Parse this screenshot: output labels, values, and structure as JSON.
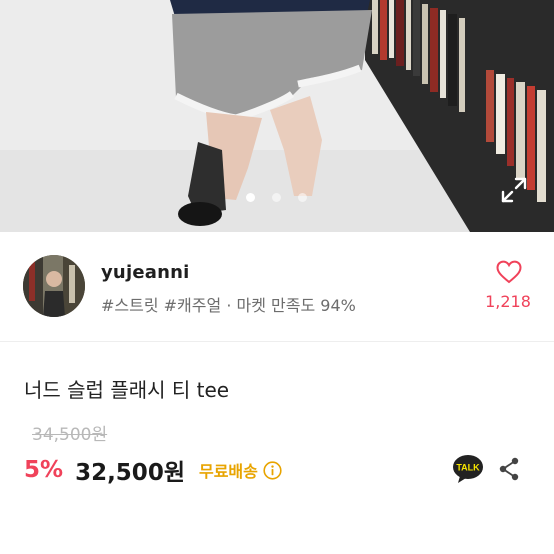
{
  "gallery": {
    "slide_count": 3,
    "active_index": 0,
    "icons": {
      "expand": "expand-icon"
    }
  },
  "seller": {
    "name": "yujeanni",
    "tags": "#스트릿 #캐주얼",
    "separator": "·",
    "satisfaction": "마켓 만족도 94%",
    "like_count": "1,218",
    "icons": {
      "like": "heart-outline-icon"
    }
  },
  "product": {
    "title": "너드 슬럽 플래시 티 tee",
    "original_price": "34,500원",
    "discount": "5%",
    "price": "32,500원",
    "shipping": "무료배송",
    "talk_label": "TALK",
    "icons": {
      "info": "info-circle-icon",
      "talk": "kakaotalk-icon",
      "share": "share-icon"
    }
  },
  "colors": {
    "accent": "#f0425a",
    "shipping": "#e8a400",
    "kakao": "#222222",
    "muted": "#6d6d6d",
    "strike": "#b8b8b8"
  }
}
